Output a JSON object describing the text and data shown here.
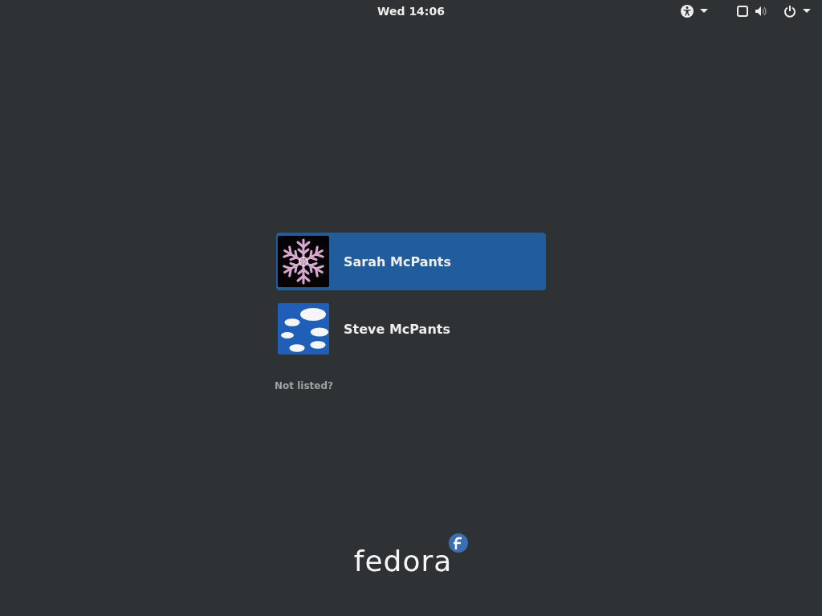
{
  "top_bar": {
    "clock": "Wed 14:06"
  },
  "users": [
    {
      "name": "Sarah McPants",
      "kind": "snowflake",
      "selected": true
    },
    {
      "name": "Steve McPants",
      "kind": "clouds",
      "selected": false
    }
  ],
  "not_listed": "Not listed?",
  "logo": {
    "wordmark": "fedora"
  }
}
